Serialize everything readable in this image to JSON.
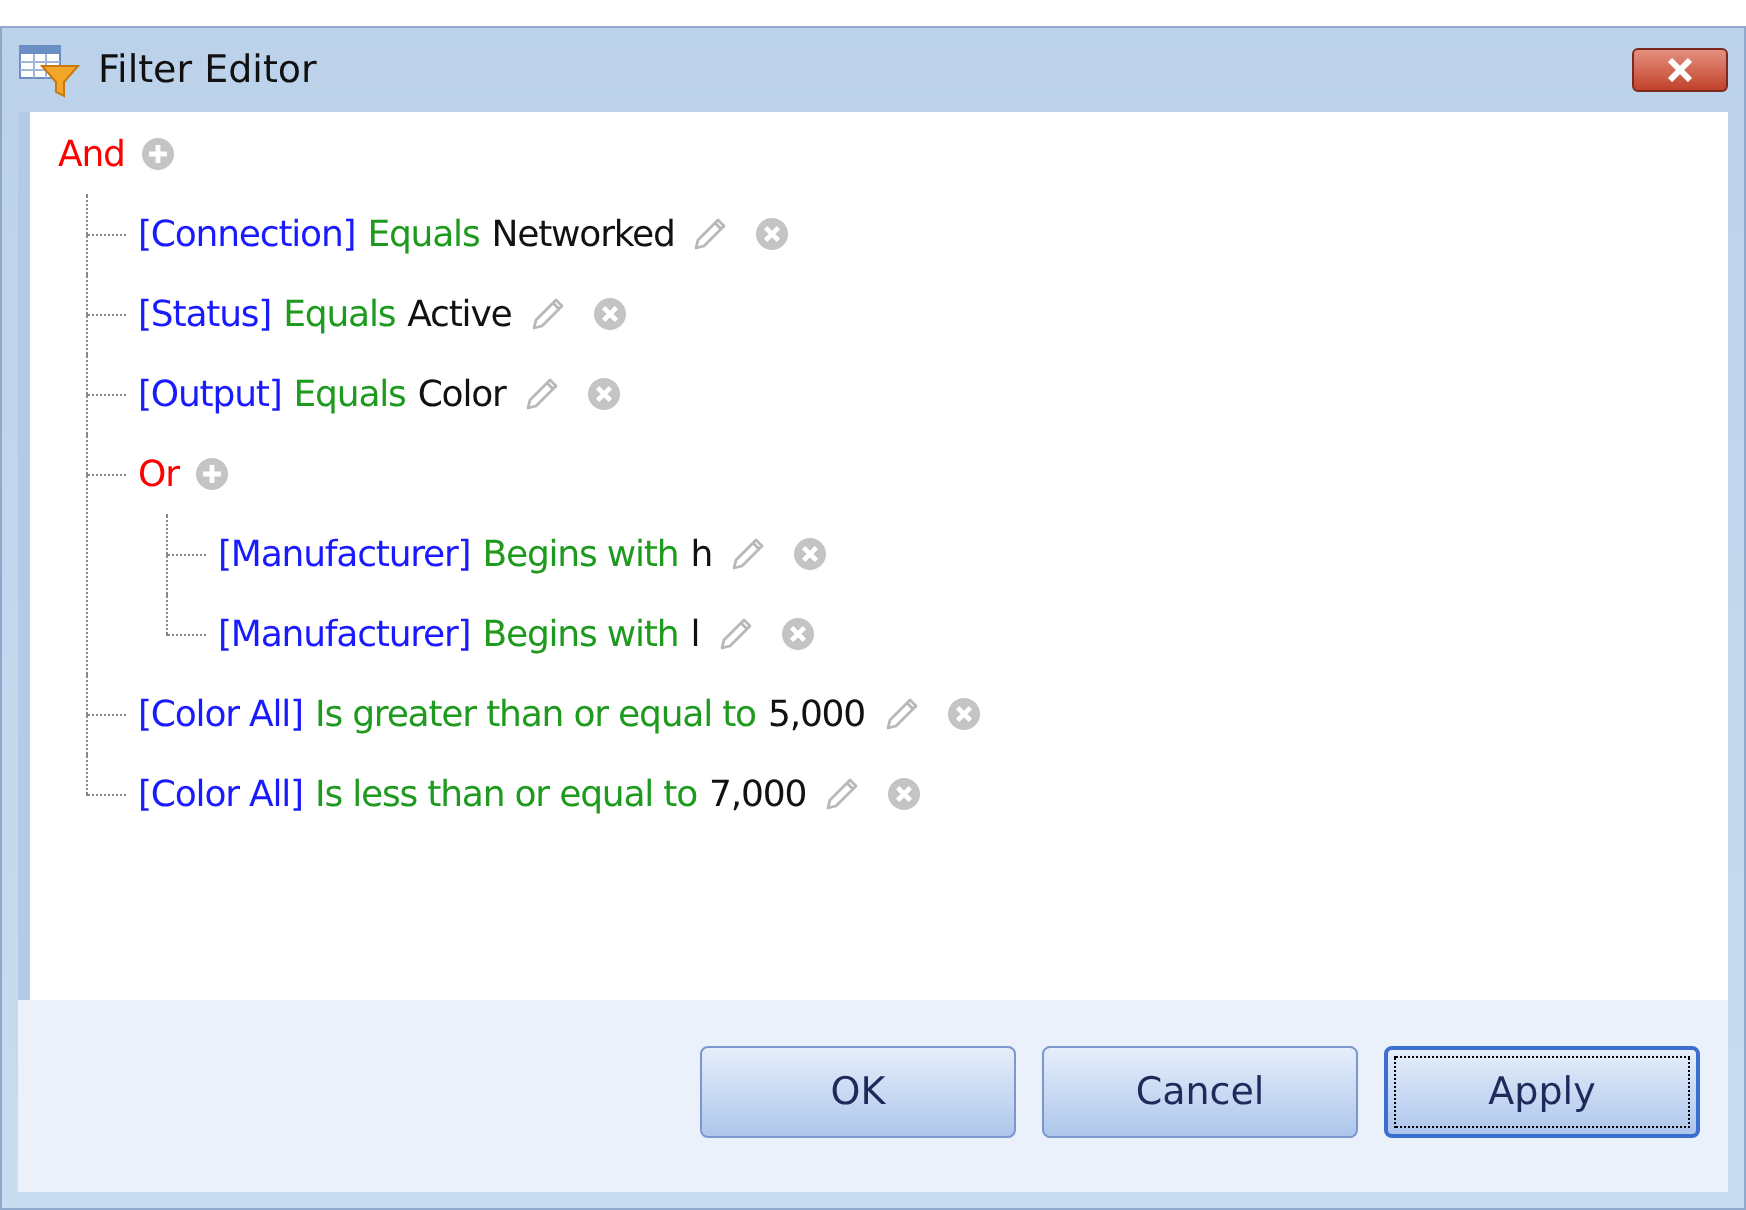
{
  "window": {
    "title": "Filter Editor"
  },
  "filter": {
    "kind": "group",
    "operator": "And",
    "children": [
      {
        "kind": "condition",
        "field": "[Connection]",
        "operation": "Equals",
        "value": "Networked"
      },
      {
        "kind": "condition",
        "field": "[Status]",
        "operation": "Equals",
        "value": "Active"
      },
      {
        "kind": "condition",
        "field": "[Output]",
        "operation": "Equals",
        "value": "Color"
      },
      {
        "kind": "group",
        "operator": "Or",
        "children": [
          {
            "kind": "condition",
            "field": "[Manufacturer]",
            "operation": "Begins with",
            "value": "h"
          },
          {
            "kind": "condition",
            "field": "[Manufacturer]",
            "operation": "Begins with",
            "value": "l"
          }
        ]
      },
      {
        "kind": "condition",
        "field": "[Color All]",
        "operation": "Is greater than or equal to",
        "value": "5,000"
      },
      {
        "kind": "condition",
        "field": "[Color All]",
        "operation": "Is less than or equal to",
        "value": "7,000"
      }
    ]
  },
  "buttons": [
    {
      "label": "OK",
      "focused": false
    },
    {
      "label": "Cancel",
      "focused": false
    },
    {
      "label": "Apply",
      "focused": true
    }
  ]
}
